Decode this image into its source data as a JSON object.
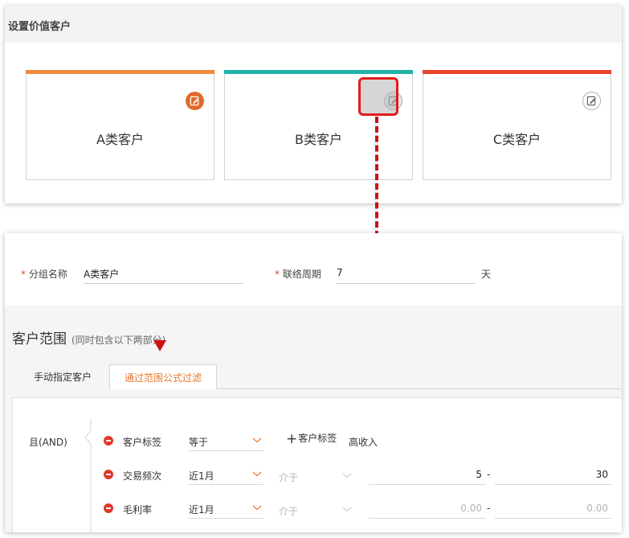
{
  "top": {
    "title": "设置价值客户",
    "cards": [
      {
        "label": "A类客户",
        "bar_color": "#ef8a3c",
        "edit_style": "filled"
      },
      {
        "label": "B类客户",
        "bar_color": "#20b2aa",
        "edit_style": "outline"
      },
      {
        "label": "C类客户",
        "bar_color": "#e8432d",
        "edit_style": "outline"
      }
    ]
  },
  "form": {
    "required_mark": "*",
    "group_name_label": "分组名称",
    "group_name_value": "A类客户",
    "cycle_label": "联络周期",
    "cycle_value": "7",
    "cycle_unit": "天"
  },
  "range": {
    "title": "客户范围",
    "note": "(同时包含以下两部分)",
    "tabs": {
      "manual": "手动指定客户",
      "formula": "通过范围公式过滤"
    },
    "logic": "且(AND)",
    "conditions": [
      {
        "field": "客户标签",
        "operator": "等于",
        "add_tag": "客户标签",
        "tag": "高收入"
      },
      {
        "field": "交易频次",
        "period": "近1月",
        "operator": "介于",
        "min": "5",
        "sep": "-",
        "max": "30"
      },
      {
        "field": "毛利率",
        "period": "近1月",
        "operator": "介于",
        "min": "0.00",
        "sep": "-",
        "max": "0.00"
      }
    ]
  },
  "colors": {
    "accent": "#e57a2f",
    "annotation": "#cc1111",
    "danger": "#e0382a"
  }
}
